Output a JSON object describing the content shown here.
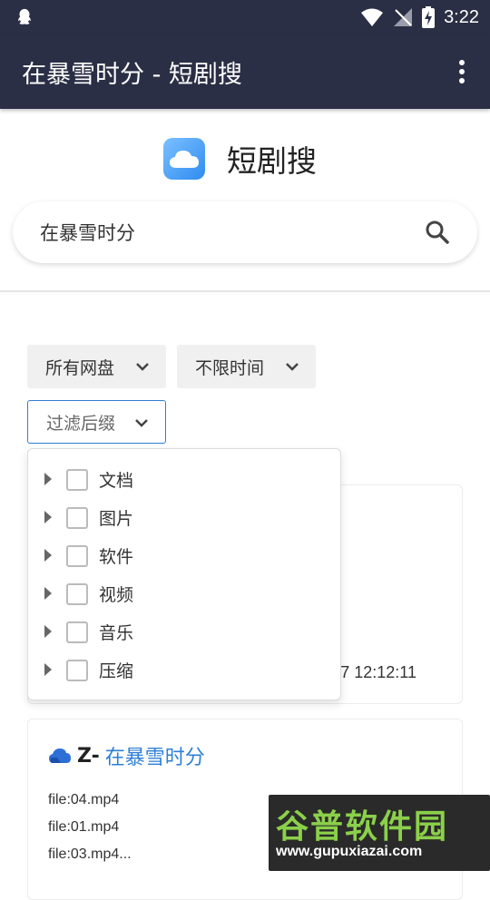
{
  "statusbar": {
    "time": "3:22"
  },
  "appbar": {
    "title": "在暴雪时分 - 短剧搜"
  },
  "brand": {
    "name": "短剧搜"
  },
  "search": {
    "value": "在暴雪时分"
  },
  "filters": {
    "disk": "所有网盘",
    "time": "不限时间",
    "suffix": "过滤后缀"
  },
  "dropdown": {
    "items": [
      "文档",
      "图片",
      "软件",
      "视频",
      "音乐",
      "压缩"
    ]
  },
  "card1": {
    "date_fragment": "7 12:12:11"
  },
  "card2": {
    "prefix": "Z-",
    "title": "在暴雪时分",
    "files": [
      "file:04.mp4",
      "file:01.mp4",
      "file:03.mp4..."
    ]
  },
  "watermark": {
    "main": "谷普软件园",
    "url": "www.gupuxiazai.com"
  }
}
